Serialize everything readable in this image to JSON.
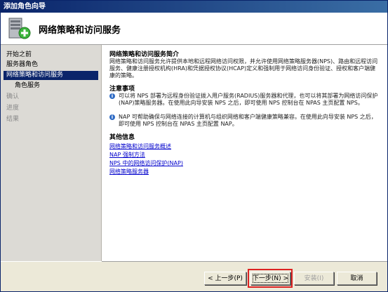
{
  "window": {
    "title": "添加角色向导"
  },
  "header": {
    "title": "网络策略和访问服务",
    "icon": "server-role-add-icon"
  },
  "sidebar": {
    "items": [
      {
        "label": "开始之前",
        "state": "normal"
      },
      {
        "label": "服务器角色",
        "state": "normal"
      },
      {
        "label": "网络策略和访问服务",
        "state": "selected"
      },
      {
        "label": "角色服务",
        "state": "sub"
      },
      {
        "label": "确认",
        "state": "disabled"
      },
      {
        "label": "进度",
        "state": "disabled"
      },
      {
        "label": "结果",
        "state": "disabled"
      }
    ]
  },
  "main": {
    "intro_heading": "网络策略和访问服务简介",
    "intro_text": "网络策略和访问服务允许提供本地和远程网络访问权限，并允许使用网络策略服务器(NPS)、路由和远程访问服务、健康注册授权机构(HRA)和凭据授权协议(HCAP)定义和强制用于网络访问身份验证、授权和客户端健康的策略。",
    "notes_heading": "注意事项",
    "notes": [
      "可以将 NPS 部署为远程身份验证拨入用户服务(RADIUS)服务器和代理，也可以将其部署为网络访问保护(NAP)策略服务器。在使用此向导安装 NPS 之后，即可使用 NPS 控制台在 NPAS 主页配置 NPS。",
      "NAP 可帮助确保与网络连接的计算机与组织网络和客户端健康策略兼容。在使用此向导安装 NPS 之后，即可使用 NPS 控制台在 NPAS 主页配置 NAP。"
    ],
    "more_heading": "其他信息",
    "links": [
      "网络策略和访问服务概述",
      "NAP 强制方法",
      "NPS 中的网络访问保护(NAP)",
      "网络策略服务器"
    ]
  },
  "footer": {
    "back_label": "< 上一步(P)",
    "next_label": "下一步(N) >",
    "install_label": "安装(I)",
    "cancel_label": "取消"
  }
}
